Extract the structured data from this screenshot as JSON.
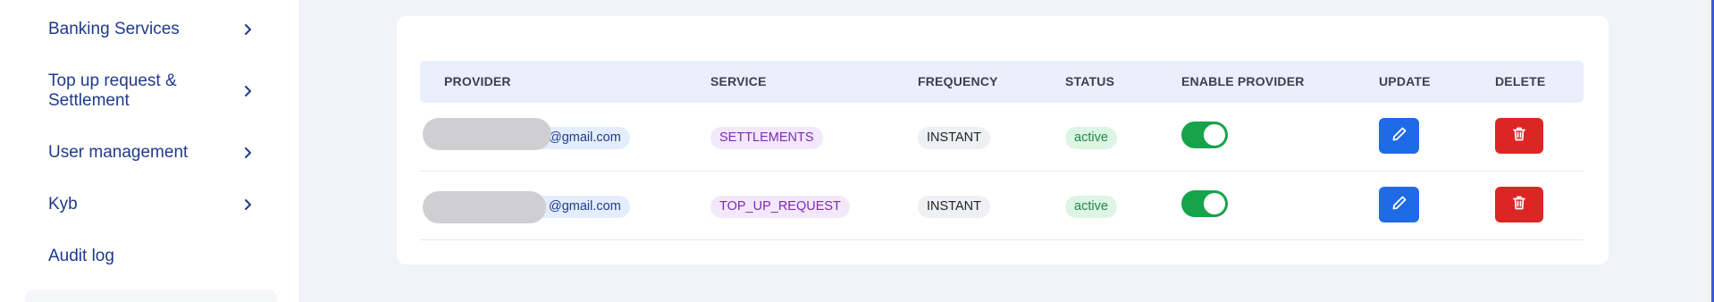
{
  "sidebar": {
    "items": [
      {
        "label": "Banking Services",
        "has_chevron": true
      },
      {
        "label": "Top up request & Settlement",
        "has_chevron": true
      },
      {
        "label": "User management",
        "has_chevron": true
      },
      {
        "label": "Kyb",
        "has_chevron": true
      },
      {
        "label": "Audit log",
        "has_chevron": false
      }
    ]
  },
  "table": {
    "headers": [
      "PROVIDER",
      "SERVICE",
      "FREQUENCY",
      "STATUS",
      "ENABLE PROVIDER",
      "UPDATE",
      "DELETE"
    ],
    "rows": [
      {
        "provider": "@gmail.com",
        "service": "SETTLEMENTS",
        "frequency": "INSTANT",
        "status": "active",
        "enabled": true
      },
      {
        "provider": "@gmail.com",
        "service": "TOP_UP_REQUEST",
        "frequency": "INSTANT",
        "status": "active",
        "enabled": true
      }
    ]
  },
  "icons": {
    "nav_chevron": "chevron-right-icon",
    "update": "pencil-icon",
    "delete": "trash-icon"
  },
  "colors": {
    "accent": "#1e3a8a",
    "edit_button": "#1f6ae6",
    "delete_button": "#dc2626",
    "toggle_on": "#16a34a",
    "status_active": "#1e8a45",
    "service_pill": "#7b2cb1"
  }
}
